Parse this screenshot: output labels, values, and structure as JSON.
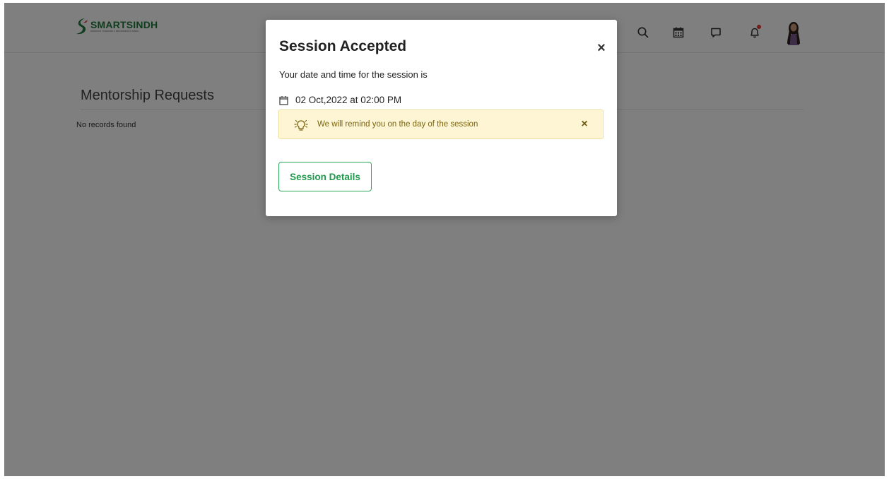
{
  "header": {
    "logo_text": "SMARTSINDH",
    "logo_tagline": "WORKING TOWARDS A PROSPEROUS SINDH",
    "icons": [
      "search-icon",
      "calendar-icon",
      "chat-icon",
      "bell-icon",
      "avatar"
    ]
  },
  "page": {
    "title": "Mentorship Requests",
    "empty_message": "No records found"
  },
  "modal": {
    "title": "Session Accepted",
    "close_label": "×",
    "subtitle": "Your date and time for the session is",
    "datetime": "02 Oct,2022 at 02:00 PM",
    "alert": {
      "text": "We will remind you on the day of the session",
      "close_label": "×"
    },
    "details_button": "Session Details"
  },
  "colors": {
    "brand_green": "#1f9a4d",
    "alert_bg": "#fdf5d3",
    "notification_dot": "#e53935"
  }
}
